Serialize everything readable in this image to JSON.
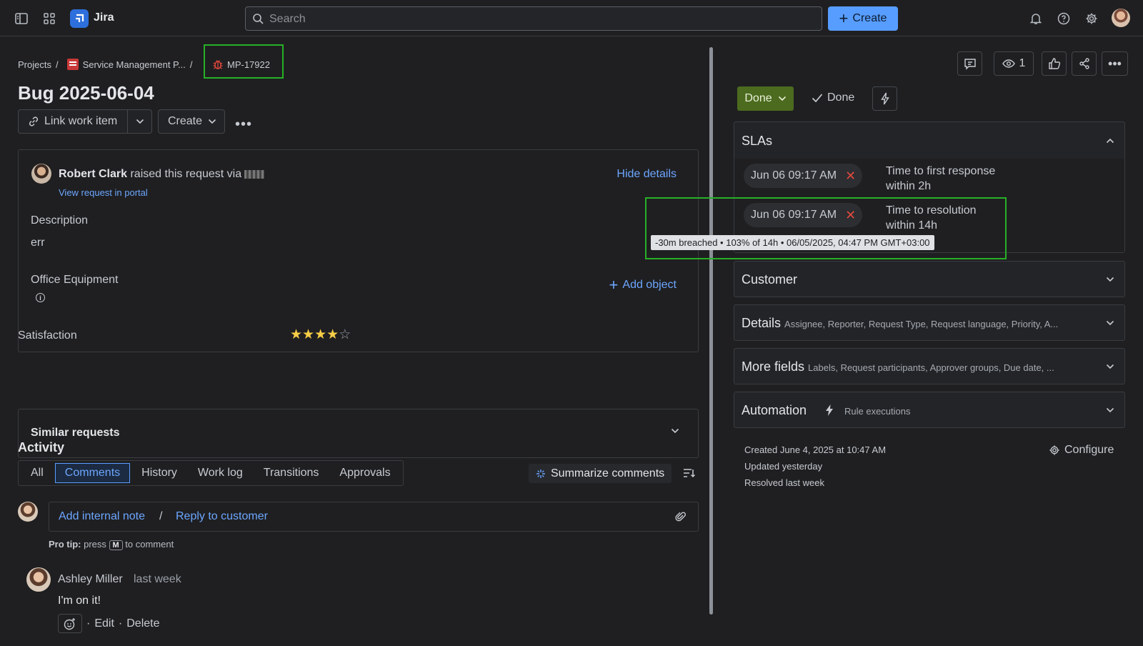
{
  "topbar": {
    "app_name": "Jira",
    "search_placeholder": "Search",
    "create_label": "Create"
  },
  "breadcrumb": {
    "projects": "Projects",
    "sep": "/",
    "project": "Service Management P...",
    "issue_key": "MP-17922"
  },
  "issue": {
    "title": "Bug 2025-06-04",
    "link_work_item": "Link work item",
    "create": "Create"
  },
  "request": {
    "requester": "Robert Clark",
    "raised_text": " raised this request via",
    "view_portal": "View request in portal",
    "hide_details": "Hide details",
    "description_label": "Description",
    "description_value": "err",
    "office_label": "Office Equipment",
    "add_object": "Add object"
  },
  "satisfaction": {
    "label": "Satisfaction",
    "rating": 4,
    "max": 5
  },
  "similar": {
    "label": "Similar requests"
  },
  "activity": {
    "heading": "Activity",
    "tabs": [
      "All",
      "Comments",
      "History",
      "Work log",
      "Transitions",
      "Approvals"
    ],
    "active_tab": "Comments",
    "summarize": "Summarize comments",
    "add_internal_note": "Add internal note",
    "sep": "/",
    "reply_to_customer": "Reply to customer",
    "protip_bold": "Pro tip:",
    "protip_press": " press ",
    "protip_key": "M",
    "protip_rest": " to comment",
    "comment": {
      "author": "Ashley Miller",
      "time": "last week",
      "body": "I'm on it!",
      "edit": "Edit",
      "delete": "Delete",
      "dot": "·"
    }
  },
  "right": {
    "watch_count": "1",
    "status": "Done",
    "resolution": "Done",
    "slas": {
      "heading": "SLAs",
      "items": [
        {
          "time": "Jun 06 09:17 AM",
          "line1": "Time to first response",
          "line2": "within 2h"
        },
        {
          "time": "Jun 06 09:17 AM",
          "line1": "Time to resolution",
          "line2": "within 14h"
        }
      ],
      "tooltip": "-30m breached • 103% of 14h • 06/05/2025, 04:47 PM GMT+03:00"
    },
    "customer": "Customer",
    "details": {
      "title": "Details",
      "sub": "Assignee, Reporter, Request Type, Request language, Priority, A..."
    },
    "more_fields": {
      "title": "More fields",
      "sub": "Labels, Request participants, Approver groups, Due date, ..."
    },
    "automation": {
      "title": "Automation",
      "sub": "Rule executions"
    },
    "created": "Created June 4, 2025 at 10:47 AM",
    "updated": "Updated yesterday",
    "resolved": "Resolved last week",
    "configure": "Configure"
  },
  "colors": {
    "accent": "#579dff",
    "status_done": "#4c6b1f",
    "highlight": "#27b027",
    "breach": "#e2483d"
  }
}
